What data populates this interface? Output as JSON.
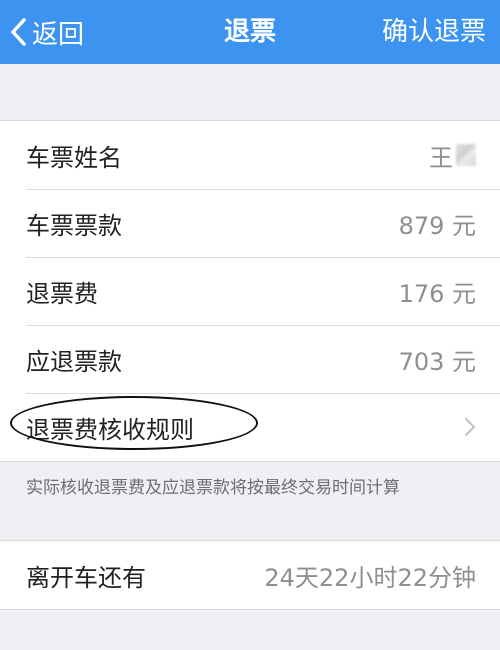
{
  "nav": {
    "back_label": "返回",
    "title": "退票",
    "confirm_label": "确认退票",
    "bar_color": "#3d93f0"
  },
  "refund": {
    "rows": [
      {
        "label": "车票姓名",
        "value": "王"
      },
      {
        "label": "车票票款",
        "value": "879 元"
      },
      {
        "label": "退票费",
        "value": "176 元"
      },
      {
        "label": "应退票款",
        "value": "703 元"
      }
    ],
    "rule_label": "退票费核收规则"
  },
  "note": "实际核收退票费及应退票款将按最终交易时间计算",
  "departure": {
    "label": "离开车还有",
    "value": "24天22小时22分钟"
  },
  "icons": [
    "chevron-left-icon",
    "chevron-right-icon"
  ]
}
